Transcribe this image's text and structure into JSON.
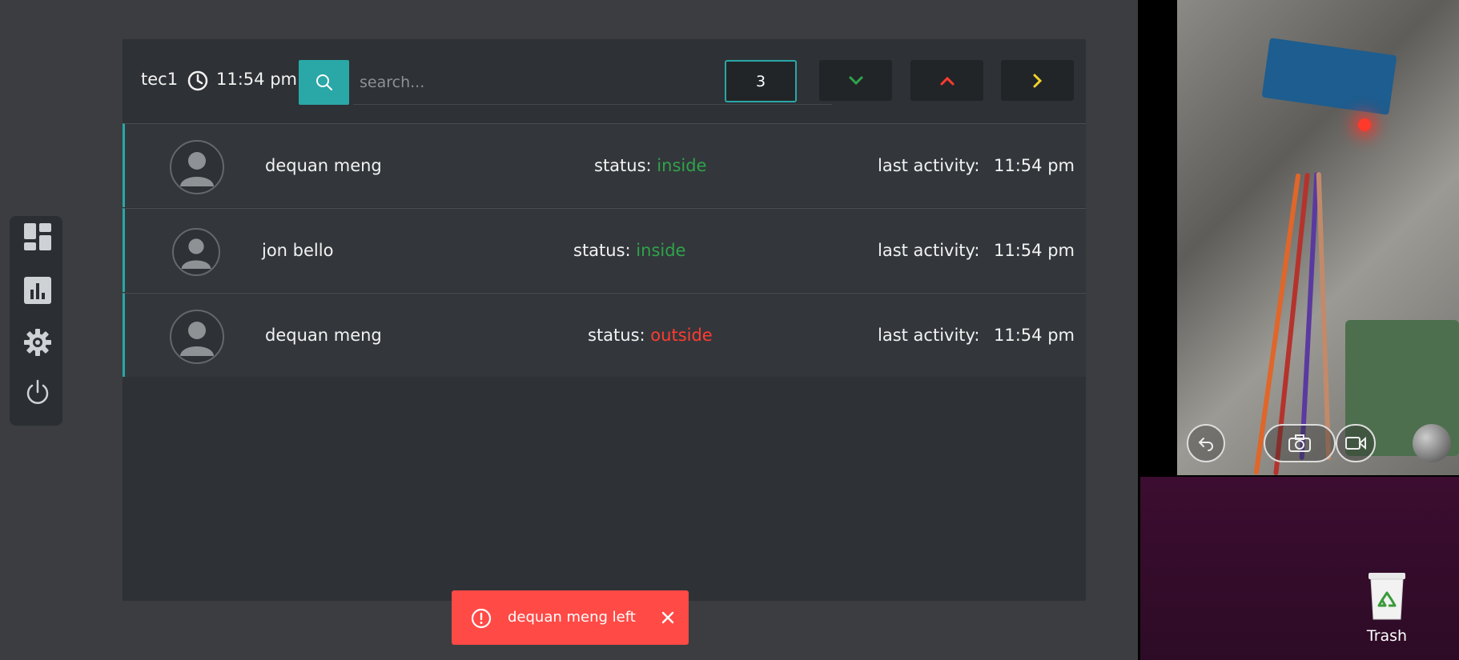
{
  "toolbar": {
    "user": "tec1",
    "time": "11:54 pm",
    "search_placeholder": "search...",
    "count": "3"
  },
  "rows": [
    {
      "name": "dequan meng",
      "status_label": "status:",
      "status_value": "inside",
      "activity_label": "last activity:",
      "activity_time": "11:54 pm"
    },
    {
      "name": "jon bello",
      "status_label": "status:",
      "status_value": "inside",
      "activity_label": "last activity:",
      "activity_time": "11:54 pm"
    },
    {
      "name": "dequan meng",
      "status_label": "status:",
      "status_value": "outside",
      "activity_label": "last activity:",
      "activity_time": "11:54 pm"
    }
  ],
  "toast": {
    "message": "dequan meng left"
  },
  "desktop": {
    "trash_label": "Trash"
  },
  "colors": {
    "accent": "#2aa7a7",
    "inside": "#2fa34a",
    "outside": "#ff3b30",
    "toast": "#ff4a46",
    "chevron_down": "#2fa34a",
    "chevron_up": "#ff3b30",
    "chevron_right": "#f2d22e"
  },
  "icons": {
    "sidebar": [
      "dashboard-icon",
      "chart-icon",
      "settings-icon",
      "power-icon"
    ],
    "toolbar": [
      "clock-icon",
      "search-icon",
      "chevron-down-icon",
      "chevron-up-icon",
      "chevron-right-icon"
    ],
    "camera": [
      "back-icon",
      "camera-icon",
      "video-icon"
    ]
  }
}
